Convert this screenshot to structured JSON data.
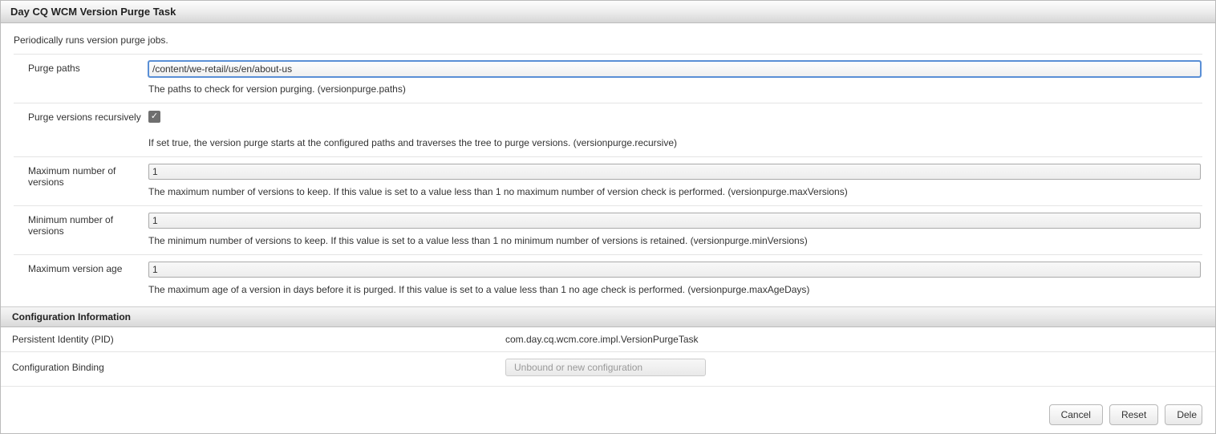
{
  "dialog": {
    "title": "Day CQ WCM Version Purge Task",
    "description": "Periodically runs version purge jobs."
  },
  "fields": {
    "purgePaths": {
      "label": "Purge paths",
      "value": "/content/we-retail/us/en/about-us",
      "help": "The paths to check for version purging. (versionpurge.paths)"
    },
    "recursive": {
      "label": "Purge versions recursively",
      "checked": true,
      "help": "If set true, the version purge starts at the configured paths and traverses the tree to purge versions. (versionpurge.recursive)"
    },
    "maxVersions": {
      "label": "Maximum number of versions",
      "value": "1",
      "help": "The maximum number of versions to keep. If this value is set to a value less than 1 no maximum number of version check is performed. (versionpurge.maxVersions)"
    },
    "minVersions": {
      "label": "Minimum number of versions",
      "value": "1",
      "help": "The minimum number of versions to keep. If this value is set to a value less than 1 no minimum number of versions is retained. (versionpurge.minVersions)"
    },
    "maxAge": {
      "label": "Maximum version age",
      "value": "1",
      "help": "The maximum age of a version in days before it is purged. If this value is set to a value less than 1 no age check is performed. (versionpurge.maxAgeDays)"
    }
  },
  "configInfo": {
    "heading": "Configuration Information",
    "rows": {
      "pid": {
        "label": "Persistent Identity (PID)",
        "value": "com.day.cq.wcm.core.impl.VersionPurgeTask"
      },
      "binding": {
        "label": "Configuration Binding",
        "value": "Unbound or new configuration"
      }
    }
  },
  "buttons": {
    "cancel": "Cancel",
    "reset": "Reset",
    "delete": "Dele"
  }
}
